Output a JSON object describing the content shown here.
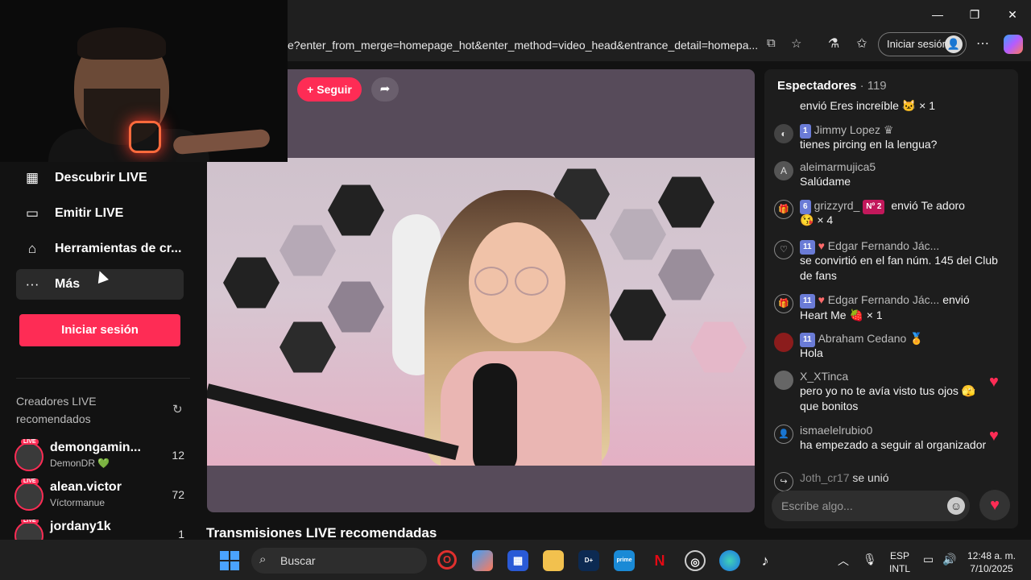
{
  "browser": {
    "url": "e?enter_from_merge=homepage_hot&enter_method=video_head&entrance_detail=homepa...",
    "signin_label": "Iniciar sesión",
    "window_controls": {
      "minimize": "—",
      "restore": "❐",
      "close": "✕"
    }
  },
  "sidebar": {
    "items": [
      {
        "label": "Descubrir LIVE",
        "icon": "calendar-icon"
      },
      {
        "label": "Emitir LIVE",
        "icon": "camera-icon"
      },
      {
        "label": "Herramientas de cr...",
        "icon": "tools-icon"
      },
      {
        "label": "Más",
        "icon": "more-icon"
      }
    ],
    "login_button": "Iniciar sesión",
    "recommended_title": "Creadores LIVE recomendados",
    "creators": [
      {
        "name": "demongamin...",
        "sub": "DemonDR 💚",
        "count": "12"
      },
      {
        "name": "alean.victor",
        "sub": "Víctormanue",
        "count": "72"
      },
      {
        "name": "jordany1k",
        "sub": "",
        "count": "1"
      }
    ]
  },
  "player": {
    "follow_label": "+ Seguir",
    "recommended_heading": "Transmisiones LIVE recomendadas"
  },
  "chat": {
    "title": "Espectadores",
    "viewers": "· 119",
    "messages": [
      {
        "user": "",
        "level": "",
        "text": "envió Eres increíble 🐱 × 1"
      },
      {
        "user": "Jimmy Lopez",
        "level": "1",
        "text": "tienes pircing en la lengua?"
      },
      {
        "user": "aleimarmujica5",
        "level": "",
        "text": "Salúdame"
      },
      {
        "user": "grizzyrd_",
        "level": "6",
        "badge": "Nº 2",
        "inline": "envió Te adoro",
        "text": "😘 × 4"
      },
      {
        "user": "Edgar Fernando Jác...",
        "level": "11",
        "text": "se convirtió en el fan núm. 145 del Club de fans"
      },
      {
        "user": "Edgar Fernando Jác...",
        "level": "11",
        "inline": "envió",
        "text": "Heart Me 🍓 × 1"
      },
      {
        "user": "Abraham Cedano",
        "level": "11",
        "text": "Hola"
      },
      {
        "user": "X_XTinca",
        "level": "",
        "text": "pero yo no te avía visto tus ojos 🫣 que bonitos"
      },
      {
        "user": "ismaelelrubio0",
        "level": "",
        "text": "ha empezado a seguir al organizador"
      },
      {
        "user": "Joth_cr17",
        "level": "",
        "inline": "se unió",
        "text": ""
      }
    ],
    "input_placeholder": "Escribe algo..."
  },
  "taskbar": {
    "search_placeholder": "Buscar",
    "language": "ESP",
    "layout": "INTL",
    "time": "12:48 a. m.",
    "date": "7/10/2025"
  },
  "colors": {
    "accent": "#fe2c55",
    "level_badge": "#6a7bd6"
  }
}
